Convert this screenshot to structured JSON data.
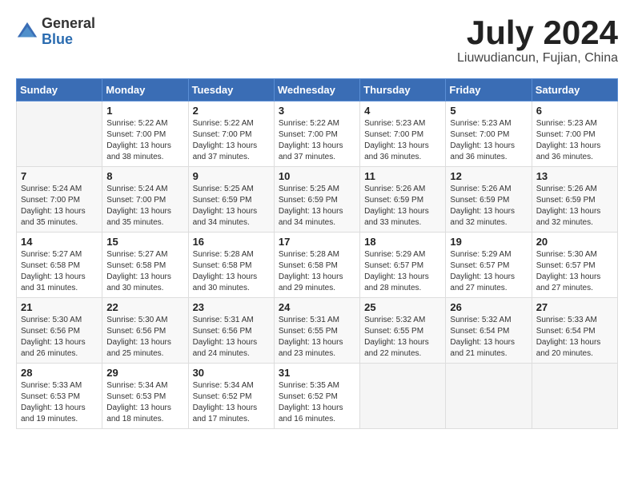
{
  "logo": {
    "general": "General",
    "blue": "Blue"
  },
  "header": {
    "month": "July 2024",
    "location": "Liuwudiancun, Fujian, China"
  },
  "weekdays": [
    "Sunday",
    "Monday",
    "Tuesday",
    "Wednesday",
    "Thursday",
    "Friday",
    "Saturday"
  ],
  "weeks": [
    [
      {
        "day": "",
        "info": ""
      },
      {
        "day": "1",
        "info": "Sunrise: 5:22 AM\nSunset: 7:00 PM\nDaylight: 13 hours\nand 38 minutes."
      },
      {
        "day": "2",
        "info": "Sunrise: 5:22 AM\nSunset: 7:00 PM\nDaylight: 13 hours\nand 37 minutes."
      },
      {
        "day": "3",
        "info": "Sunrise: 5:22 AM\nSunset: 7:00 PM\nDaylight: 13 hours\nand 37 minutes."
      },
      {
        "day": "4",
        "info": "Sunrise: 5:23 AM\nSunset: 7:00 PM\nDaylight: 13 hours\nand 36 minutes."
      },
      {
        "day": "5",
        "info": "Sunrise: 5:23 AM\nSunset: 7:00 PM\nDaylight: 13 hours\nand 36 minutes."
      },
      {
        "day": "6",
        "info": "Sunrise: 5:23 AM\nSunset: 7:00 PM\nDaylight: 13 hours\nand 36 minutes."
      }
    ],
    [
      {
        "day": "7",
        "info": "Sunrise: 5:24 AM\nSunset: 7:00 PM\nDaylight: 13 hours\nand 35 minutes."
      },
      {
        "day": "8",
        "info": "Sunrise: 5:24 AM\nSunset: 7:00 PM\nDaylight: 13 hours\nand 35 minutes."
      },
      {
        "day": "9",
        "info": "Sunrise: 5:25 AM\nSunset: 6:59 PM\nDaylight: 13 hours\nand 34 minutes."
      },
      {
        "day": "10",
        "info": "Sunrise: 5:25 AM\nSunset: 6:59 PM\nDaylight: 13 hours\nand 34 minutes."
      },
      {
        "day": "11",
        "info": "Sunrise: 5:26 AM\nSunset: 6:59 PM\nDaylight: 13 hours\nand 33 minutes."
      },
      {
        "day": "12",
        "info": "Sunrise: 5:26 AM\nSunset: 6:59 PM\nDaylight: 13 hours\nand 32 minutes."
      },
      {
        "day": "13",
        "info": "Sunrise: 5:26 AM\nSunset: 6:59 PM\nDaylight: 13 hours\nand 32 minutes."
      }
    ],
    [
      {
        "day": "14",
        "info": "Sunrise: 5:27 AM\nSunset: 6:58 PM\nDaylight: 13 hours\nand 31 minutes."
      },
      {
        "day": "15",
        "info": "Sunrise: 5:27 AM\nSunset: 6:58 PM\nDaylight: 13 hours\nand 30 minutes."
      },
      {
        "day": "16",
        "info": "Sunrise: 5:28 AM\nSunset: 6:58 PM\nDaylight: 13 hours\nand 30 minutes."
      },
      {
        "day": "17",
        "info": "Sunrise: 5:28 AM\nSunset: 6:58 PM\nDaylight: 13 hours\nand 29 minutes."
      },
      {
        "day": "18",
        "info": "Sunrise: 5:29 AM\nSunset: 6:57 PM\nDaylight: 13 hours\nand 28 minutes."
      },
      {
        "day": "19",
        "info": "Sunrise: 5:29 AM\nSunset: 6:57 PM\nDaylight: 13 hours\nand 27 minutes."
      },
      {
        "day": "20",
        "info": "Sunrise: 5:30 AM\nSunset: 6:57 PM\nDaylight: 13 hours\nand 27 minutes."
      }
    ],
    [
      {
        "day": "21",
        "info": "Sunrise: 5:30 AM\nSunset: 6:56 PM\nDaylight: 13 hours\nand 26 minutes."
      },
      {
        "day": "22",
        "info": "Sunrise: 5:30 AM\nSunset: 6:56 PM\nDaylight: 13 hours\nand 25 minutes."
      },
      {
        "day": "23",
        "info": "Sunrise: 5:31 AM\nSunset: 6:56 PM\nDaylight: 13 hours\nand 24 minutes."
      },
      {
        "day": "24",
        "info": "Sunrise: 5:31 AM\nSunset: 6:55 PM\nDaylight: 13 hours\nand 23 minutes."
      },
      {
        "day": "25",
        "info": "Sunrise: 5:32 AM\nSunset: 6:55 PM\nDaylight: 13 hours\nand 22 minutes."
      },
      {
        "day": "26",
        "info": "Sunrise: 5:32 AM\nSunset: 6:54 PM\nDaylight: 13 hours\nand 21 minutes."
      },
      {
        "day": "27",
        "info": "Sunrise: 5:33 AM\nSunset: 6:54 PM\nDaylight: 13 hours\nand 20 minutes."
      }
    ],
    [
      {
        "day": "28",
        "info": "Sunrise: 5:33 AM\nSunset: 6:53 PM\nDaylight: 13 hours\nand 19 minutes."
      },
      {
        "day": "29",
        "info": "Sunrise: 5:34 AM\nSunset: 6:53 PM\nDaylight: 13 hours\nand 18 minutes."
      },
      {
        "day": "30",
        "info": "Sunrise: 5:34 AM\nSunset: 6:52 PM\nDaylight: 13 hours\nand 17 minutes."
      },
      {
        "day": "31",
        "info": "Sunrise: 5:35 AM\nSunset: 6:52 PM\nDaylight: 13 hours\nand 16 minutes."
      },
      {
        "day": "",
        "info": ""
      },
      {
        "day": "",
        "info": ""
      },
      {
        "day": "",
        "info": ""
      }
    ]
  ]
}
